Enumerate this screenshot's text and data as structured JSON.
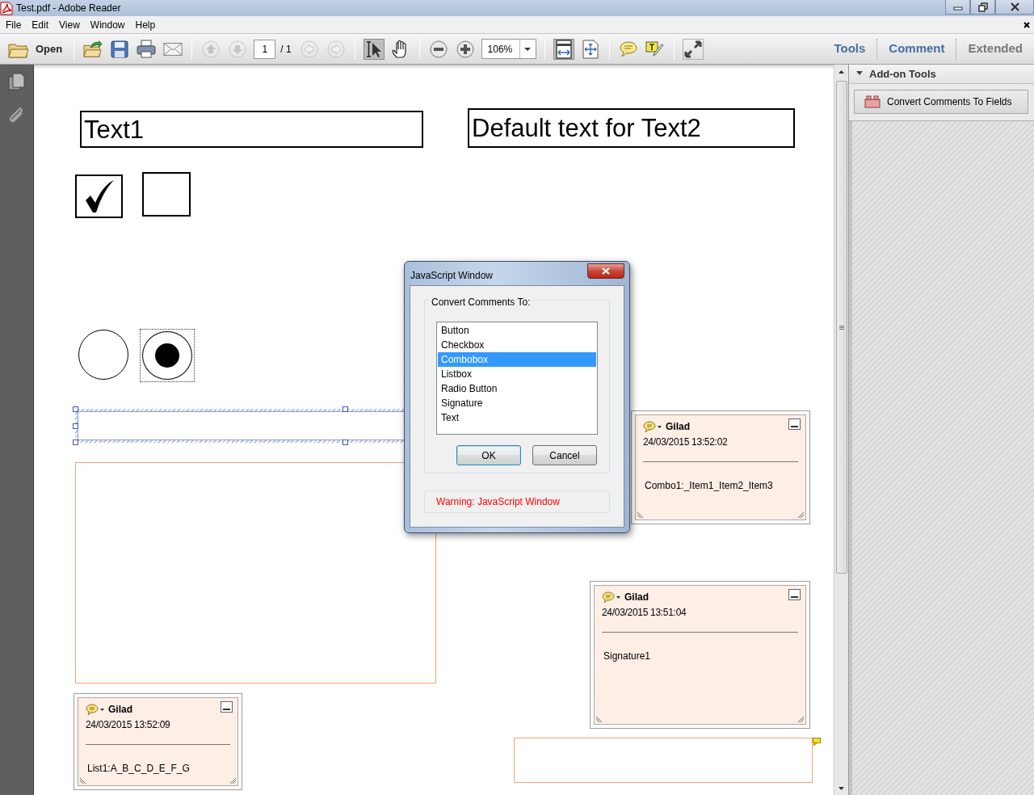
{
  "window": {
    "title": "Test.pdf - Adobe Reader"
  },
  "menu": [
    {
      "label": "File"
    },
    {
      "label": "Edit"
    },
    {
      "label": "View"
    },
    {
      "label": "Window"
    },
    {
      "label": "Help"
    }
  ],
  "toolbar": {
    "open_label": "Open",
    "groups": [
      [
        {
          "kind": "create"
        },
        {
          "kind": "save"
        },
        {
          "kind": "print"
        },
        {
          "kind": "email"
        }
      ],
      [
        {
          "kind": "page-up",
          "disabled": true
        },
        {
          "kind": "page-down",
          "disabled": true
        },
        {
          "kind": "page-field",
          "value": "1"
        },
        {
          "kind": "page-total",
          "text": "/ 1"
        },
        {
          "kind": "prev",
          "disabled": true
        },
        {
          "kind": "next",
          "disabled": true
        }
      ],
      [
        {
          "kind": "select",
          "pressed": true
        },
        {
          "kind": "hand",
          "pressed": false
        }
      ],
      [
        {
          "kind": "zoom-out"
        },
        {
          "kind": "zoom-in"
        },
        {
          "kind": "zoom-field",
          "value": "106%"
        }
      ],
      [
        {
          "kind": "fit-width",
          "pressed": true
        },
        {
          "kind": "fit-page",
          "pressed": false
        }
      ],
      [
        {
          "kind": "comment"
        },
        {
          "kind": "highlight"
        }
      ],
      [
        {
          "kind": "fullscreen"
        }
      ]
    ]
  },
  "panel_tabs": [
    {
      "label": "Tools",
      "disabled": false
    },
    {
      "label": "Comment",
      "disabled": false
    },
    {
      "label": "Extended",
      "disabled": true
    }
  ],
  "side_panel": {
    "section": "Add-on Tools",
    "expanded": true,
    "tools": [
      {
        "label": "Convert Comments To Fields"
      }
    ]
  },
  "document": {
    "text_fields": [
      {
        "value": "Text1"
      },
      {
        "value": "Default text for Text2"
      }
    ],
    "checkboxes": [
      {
        "checked": true
      },
      {
        "checked": false
      }
    ],
    "radio_buttons": [
      {
        "selected": false,
        "focused": false
      },
      {
        "selected": true,
        "focused": true
      }
    ],
    "comments": [
      {
        "author": "Gilad",
        "date": "24/03/2015 13:52:02",
        "text": "Combo1:_Item1_Item2_Item3"
      },
      {
        "author": "Gilad",
        "date": "24/03/2015 13:51:04",
        "text": "Signature1"
      },
      {
        "author": "Gilad",
        "date": "24/03/2015 13:52:09",
        "text": "List1:A_B_C_D_E_F_G"
      }
    ]
  },
  "dialog": {
    "title": "JavaScript Window",
    "group_label": "Convert Comments To:",
    "options": [
      {
        "label": "Button",
        "selected": false
      },
      {
        "label": "Checkbox",
        "selected": false
      },
      {
        "label": "Combobox",
        "selected": true
      },
      {
        "label": "Listbox",
        "selected": false
      },
      {
        "label": "Radio Button",
        "selected": false
      },
      {
        "label": "Signature",
        "selected": false
      },
      {
        "label": "Text",
        "selected": false
      }
    ],
    "buttons": [
      {
        "label": "OK",
        "default": true
      },
      {
        "label": "Cancel",
        "default": false
      }
    ],
    "warning": "Warning: JavaScript Window"
  }
}
